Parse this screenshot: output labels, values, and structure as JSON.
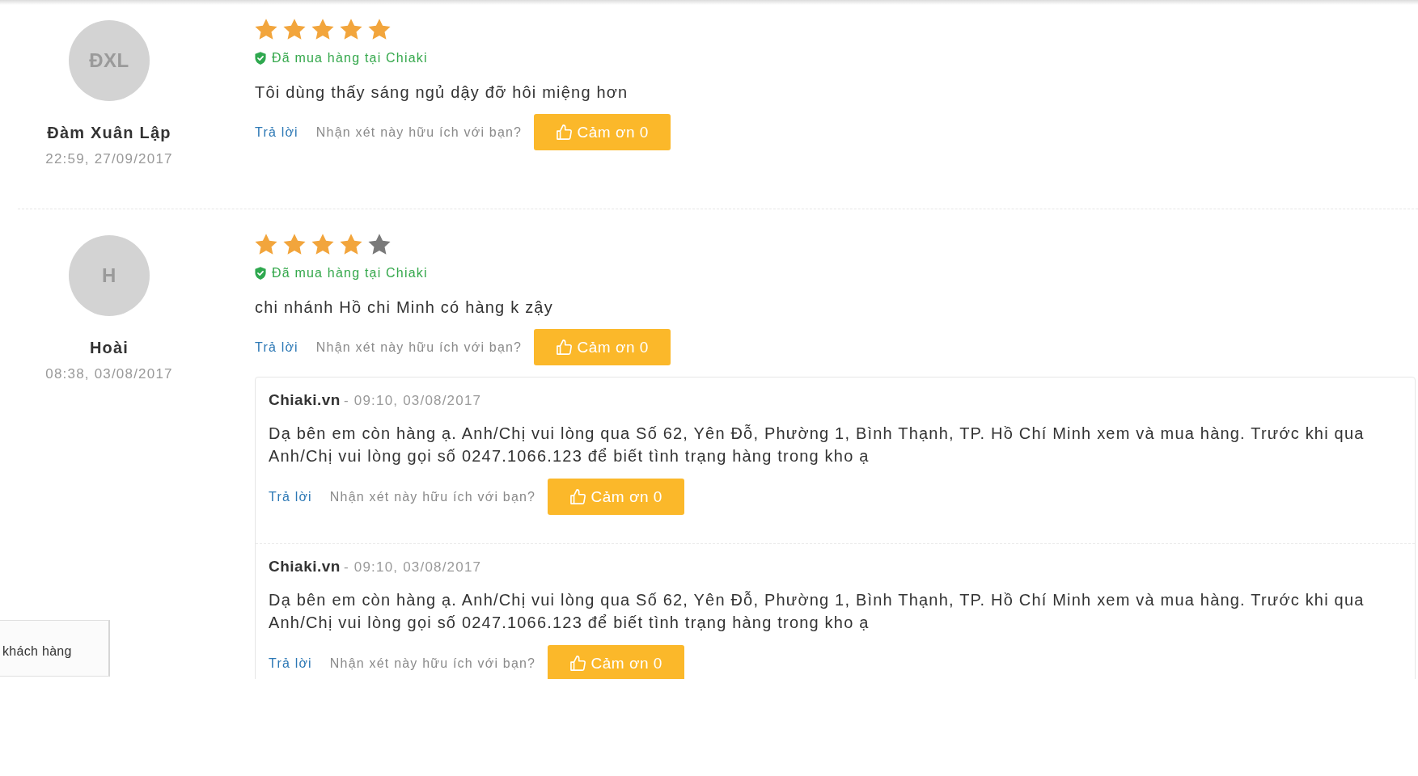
{
  "reviews": [
    {
      "initials": "ĐXL",
      "name": "Đàm Xuân Lập",
      "time": "22:59, 27/09/2017",
      "stars": 5,
      "badge": "Đã mua hàng tại Chiaki",
      "comment": "Tôi dùng thấy sáng ngủ dậy đỡ hôi miệng hơn",
      "reply_link": "Trả lời",
      "helpful_prompt": "Nhận xét này hữu ích với bạn?",
      "thanks_button": "Cảm ơn 0"
    },
    {
      "initials": "H",
      "name": "Hoài",
      "time": "08:38, 03/08/2017",
      "stars": 4,
      "badge": "Đã mua hàng tại Chiaki",
      "comment": "chi nhánh Hồ chi Minh có hàng k zậy",
      "reply_link": "Trả lời",
      "helpful_prompt": "Nhận xét này hữu ích với bạn?",
      "thanks_button": "Cảm ơn 0",
      "replies": [
        {
          "author": "Chiaki.vn",
          "time": "- 09:10, 03/08/2017",
          "text": "Dạ bên em còn hàng ạ. Anh/Chị vui lòng qua Số 62, Yên Đỗ, Phường 1, Bình Thạnh, TP. Hồ Chí Minh xem và mua hàng. Trước khi qua Anh/Chị vui lòng gọi số 0247.1066.123 để biết tình trạng hàng trong kho ạ",
          "reply_link": "Trả lời",
          "helpful_prompt": "Nhận xét này hữu ích với bạn?",
          "thanks_button": "Cảm ơn 0"
        },
        {
          "author": "Chiaki.vn",
          "time": "- 09:10, 03/08/2017",
          "text": "Dạ bên em còn hàng ạ. Anh/Chị vui lòng qua Số 62, Yên Đỗ, Phường 1, Bình Thạnh, TP. Hồ Chí Minh xem và mua hàng. Trước khi qua Anh/Chị vui lòng gọi số 0247.1066.123 để biết tình trạng hàng trong kho ạ",
          "reply_link": "Trả lời",
          "helpful_prompt": "Nhận xét này hữu ích với bạn?",
          "thanks_button": "Cảm ơn 0"
        }
      ]
    }
  ],
  "side_panel": {
    "label": "khách hàng"
  }
}
